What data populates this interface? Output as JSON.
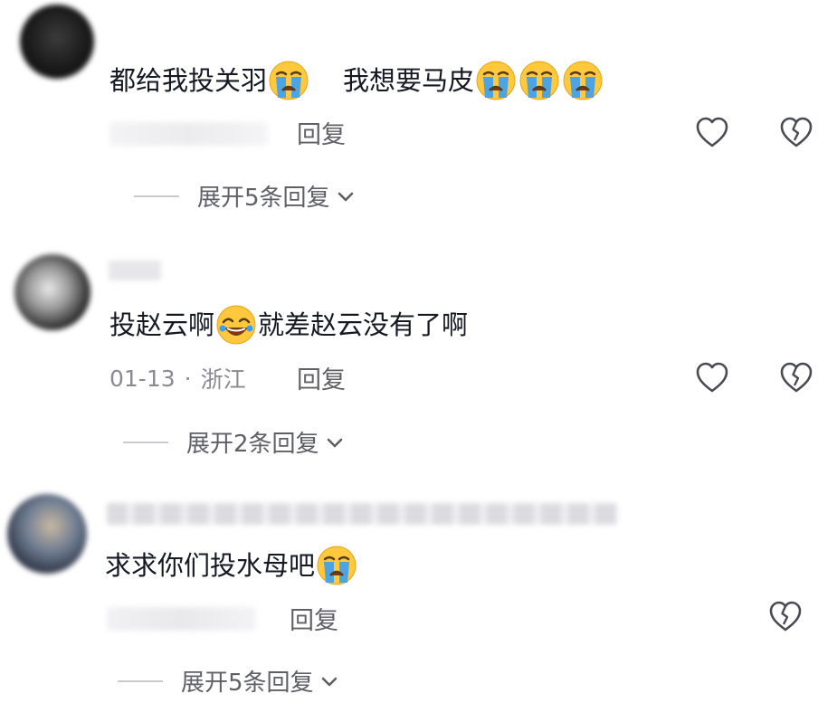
{
  "comments": [
    {
      "text_part1": "都给我投关羽",
      "text_part2": "我想要马皮",
      "emoji_part1": [
        "cry-emoji"
      ],
      "emoji_part2": [
        "cry-emoji",
        "cry-emoji",
        "cry-emoji"
      ],
      "reply_label": "回复",
      "expand_label": "展开5条回复"
    },
    {
      "text_part1": "投赵云啊",
      "text_part2": "就差赵云没有了啊",
      "date": "01-13",
      "separator": "·",
      "location": "浙江",
      "reply_label": "回复",
      "expand_label": "展开2条回复"
    },
    {
      "text_part1": "求求你们投水母吧",
      "reply_label": "回复",
      "expand_label": "展开5条回复"
    }
  ],
  "icons": {
    "like": "heart-outline-icon",
    "dislike": "broken-heart-icon",
    "expand": "chevron-down-icon"
  },
  "colors": {
    "text": "#161823",
    "meta": "#8a8b91",
    "emoji_face": "#ffc83d",
    "tear": "#3aa0f5"
  }
}
